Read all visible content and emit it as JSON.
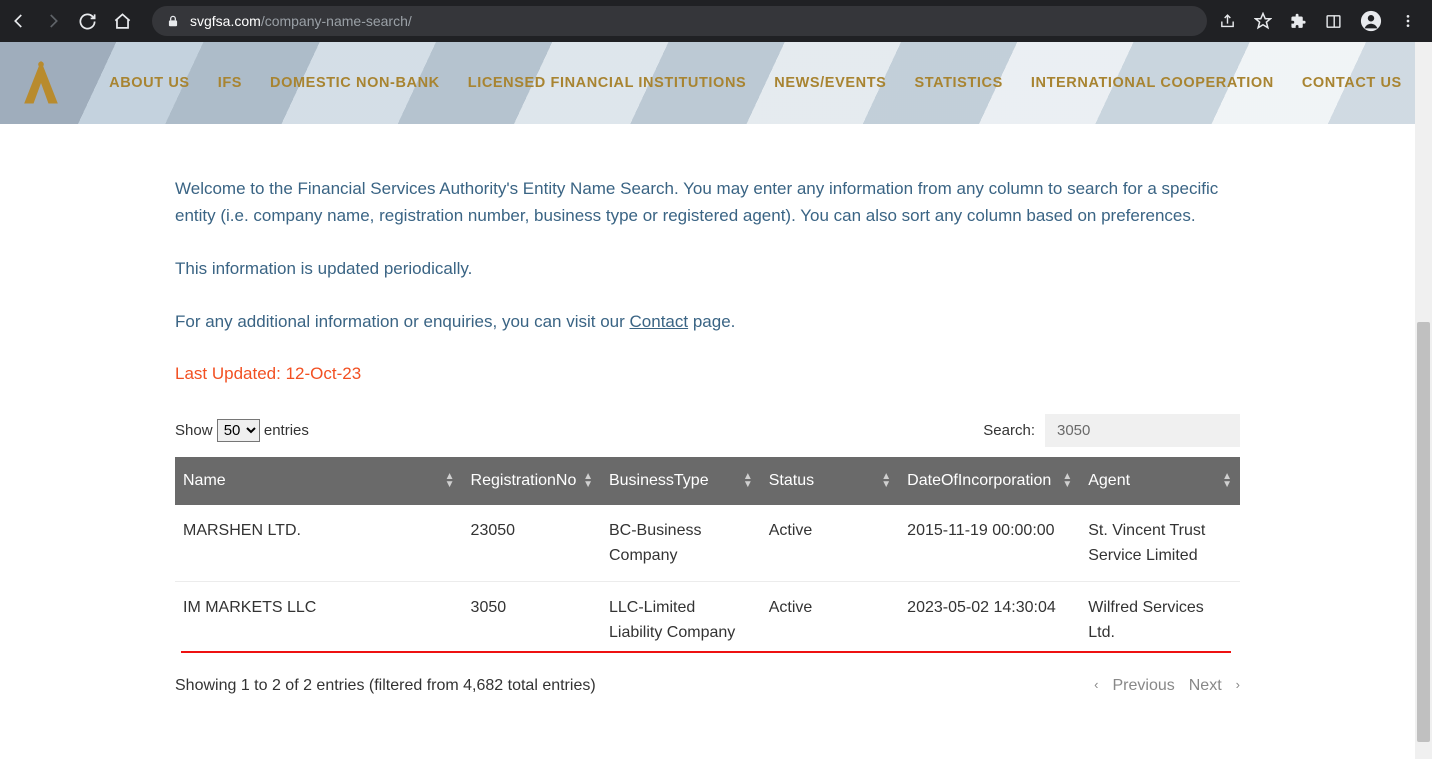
{
  "browser": {
    "url_domain": "svgfsa.com",
    "url_path": "/company-name-search/"
  },
  "nav": {
    "items": [
      "ABOUT US",
      "IFS",
      "DOMESTIC NON-BANK",
      "LICENSED FINANCIAL INSTITUTIONS",
      "NEWS/EVENTS",
      "STATISTICS",
      "INTERNATIONAL COOPERATION",
      "CONTACT US"
    ]
  },
  "intro": {
    "p1": "Welcome to the Financial Services Authority's Entity Name Search. You may enter any information from any column to search for a specific entity (i.e. company name, registration number, business type or registered agent). You can also sort any column based on preferences.",
    "p2": "This information is updated periodically.",
    "p3_prefix": "For any additional information or enquiries, you can visit our ",
    "p3_link": "Contact",
    "p3_suffix": " page."
  },
  "last_updated": "Last Updated:  12-Oct-23",
  "datatable": {
    "length_prefix": "Show ",
    "length_value": "50",
    "length_suffix": " entries",
    "search_label": "Search:",
    "search_value": "3050",
    "columns": [
      "Name",
      "RegistrationNo",
      "BusinessType",
      "Status",
      "DateOfIncorporation",
      "Agent"
    ],
    "rows": [
      {
        "name": "MARSHEN LTD.",
        "reg": "23050",
        "type": "BC-Business Company",
        "status": "Active",
        "date": "2015-11-19 00:00:00",
        "agent": "St. Vincent Trust Service Limited"
      },
      {
        "name": "IM MARKETS LLC",
        "reg": "3050",
        "type": "LLC-Limited Liability Company",
        "status": "Active",
        "date": "2023-05-02 14:30:04",
        "agent": "Wilfred Services Ltd."
      }
    ],
    "info": "Showing 1 to 2 of 2 entries (filtered from 4,682 total entries)",
    "prev": "Previous",
    "next": "Next"
  }
}
